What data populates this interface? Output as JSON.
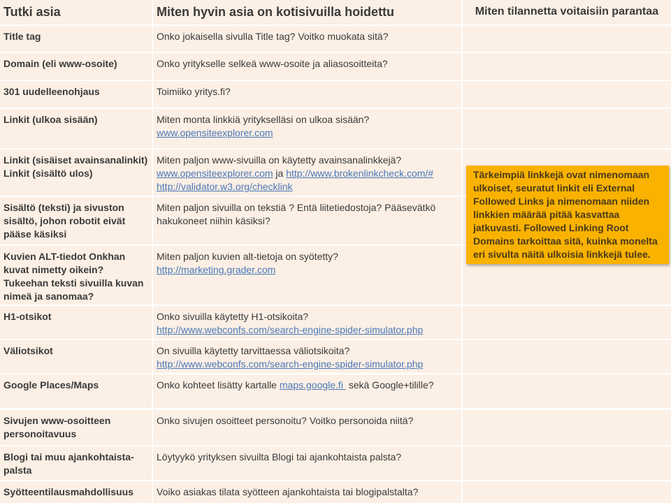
{
  "header": {
    "col1": "Tutki asia",
    "col2": "Miten hyvin asia on kotisivuilla hoidettu",
    "col3": "Miten tilannetta voitaisiin parantaa"
  },
  "rows": [
    {
      "topic": "Title tag",
      "question": "Onko jokaisella sivulla Title tag? Voitko muokata sitä?"
    },
    {
      "topic": "Domain (eli www-osoite)",
      "question": "Onko yritykselle selkeä www-osoite ja aliasosoitteita?"
    },
    {
      "topic": "301 uudelleenohjaus",
      "question": "Toimiiko yritys.fi?"
    },
    {
      "topic": "Linkit (ulkoa sisään)",
      "question": "Miten monta linkkiä yritykselläsi on ulkoa sisään?",
      "link1": "www.opensiteexplorer.com"
    },
    {
      "topic": "Linkit (sisäiset avainsanalinkit) Linkit (sisältö ulos)",
      "question": "Miten paljon  www-sivuilla on käytetty avainsanalinkkejä?",
      "link1": "www.opensiteexplorer.com",
      "joiner": " ja ",
      "link2": "http://www.brokenlinkcheck.com/#",
      "link3": "http://validator.w3.org/checklink"
    },
    {
      "topic": "Sisältö (teksti) ja sivuston sisältö, johon robotit eivät pääse käsiksi",
      "question": "Miten paljon sivuilla on tekstiä ? Entä liitetiedostoja? Pääsevätkö hakukoneet niihin käsiksi?"
    },
    {
      "topic": "Kuvien ALT-tiedot Onkhan kuvat nimetty oikein? Tukeehan teksti sivuilla  kuvan nimeä ja sanomaa?",
      "question": "Miten paljon kuvien alt-tietoja  on syötetty?",
      "link1": "http://marketing.grader.com"
    },
    {
      "topic": "H1-otsikot",
      "question": "Onko sivuilla käytetty H1-otsikoita?",
      "link1": "http://www.webconfs.com/search-engine-spider-simulator.php"
    },
    {
      "topic": "Väliotsikot",
      "question": "On sivuilla käytetty tarvittaessa väliotsikoita?",
      "link1": "http://www.webconfs.com/search-engine-spider-simulator.php"
    },
    {
      "topic": "Google Places/Maps",
      "question": "Onko kohteet lisätty kartalle ",
      "link1": "maps.google.fi ",
      "after": " sekä Google+tilille?"
    },
    {
      "topic": "Sivujen www-osoitteen personoitavuus",
      "question": "Onko sivujen osoitteet personoitu? Voitko personoida niitä?"
    },
    {
      "topic": "Blogi tai muu ajankohtaista-palsta",
      "question": "Löytyykö yrityksen sivuilta Blogi tai ajankohtaista palsta?"
    },
    {
      "topic": "Syötteentilausmahdollisuus",
      "question": "Voiko asiakas tilata syötteen ajankohtaista tai blogipalstalta?"
    }
  ],
  "callout": {
    "text": "Tärkeimpiä linkkejä ovat nimenomaan ulkoiset, seuratut linkit eli External Followed Links ja nimenomaan niiden linkkien määrää pitää kasvattaa jatkuvasti. Followed Linking Root Domains tarkoittaa sitä, kuinka monelta eri sivulta näitä ulkoisia linkkejä tulee.",
    "color": "#f9b200"
  }
}
